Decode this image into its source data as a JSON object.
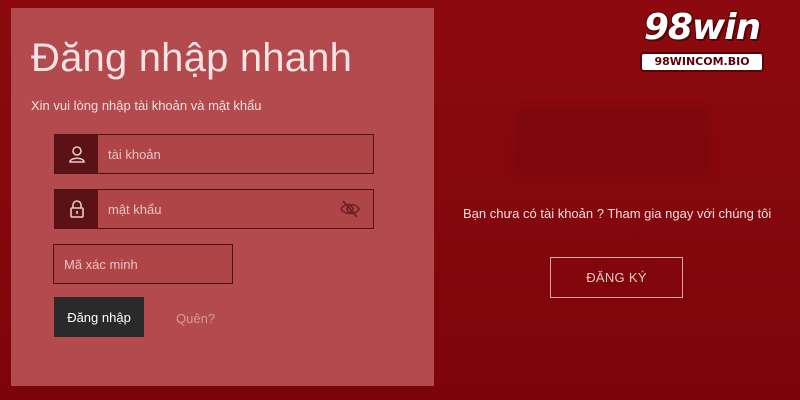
{
  "login": {
    "title": "Đăng nhập nhanh",
    "subtitle": "Xin vui lòng nhập tài khoản và mật khẩu",
    "username_placeholder": "tài khoản",
    "password_placeholder": "mật khẩu",
    "captcha_placeholder": "Mã xác minh",
    "login_label": "Đăng nhập",
    "forgot_label": "Quên?"
  },
  "register": {
    "prompt": "Bạn chưa có tài khoản ? Tham gia ngay với chúng tôi",
    "button_label": "ĐĂNG KÝ"
  },
  "brand": {
    "name": "98win",
    "domain": "98WINCOM.BIO"
  },
  "colors": {
    "background": "#8a0a0e",
    "panel": "#b34a4e",
    "icon_box": "#5b1215",
    "login_button": "#2a2a2a"
  },
  "icons": {
    "username": "user-icon",
    "password": "lock-icon",
    "toggle_password": "eye-slash-icon"
  }
}
